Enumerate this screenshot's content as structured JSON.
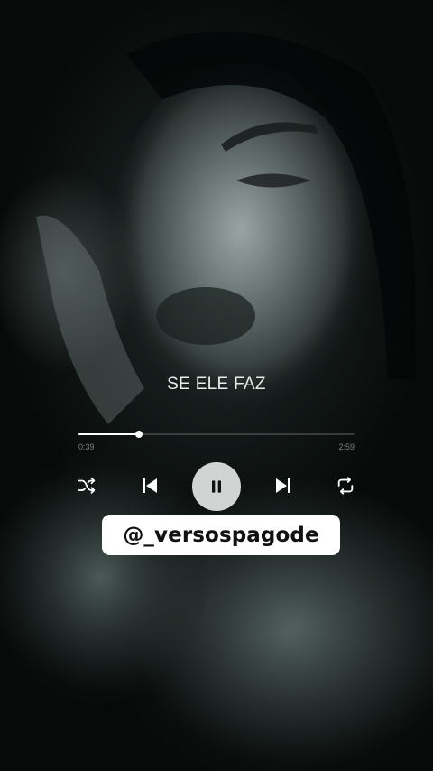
{
  "player": {
    "song_title": "SE ELE FAZ",
    "time_elapsed": "0:39",
    "time_total": "2:59",
    "progress_fraction": 0.22
  },
  "controls": {
    "shuffle_icon": "shuffle-icon",
    "previous_icon": "skip-previous-icon",
    "play_pause_icon": "pause-icon",
    "next_icon": "skip-next-icon",
    "repeat_icon": "repeat-icon"
  },
  "overlay": {
    "handle": "@_versospagode"
  },
  "colors": {
    "text": "#e9edec",
    "accent": "#ffffff",
    "play_button_bg": "#e1e6e5",
    "background": "#0b0f0e"
  }
}
